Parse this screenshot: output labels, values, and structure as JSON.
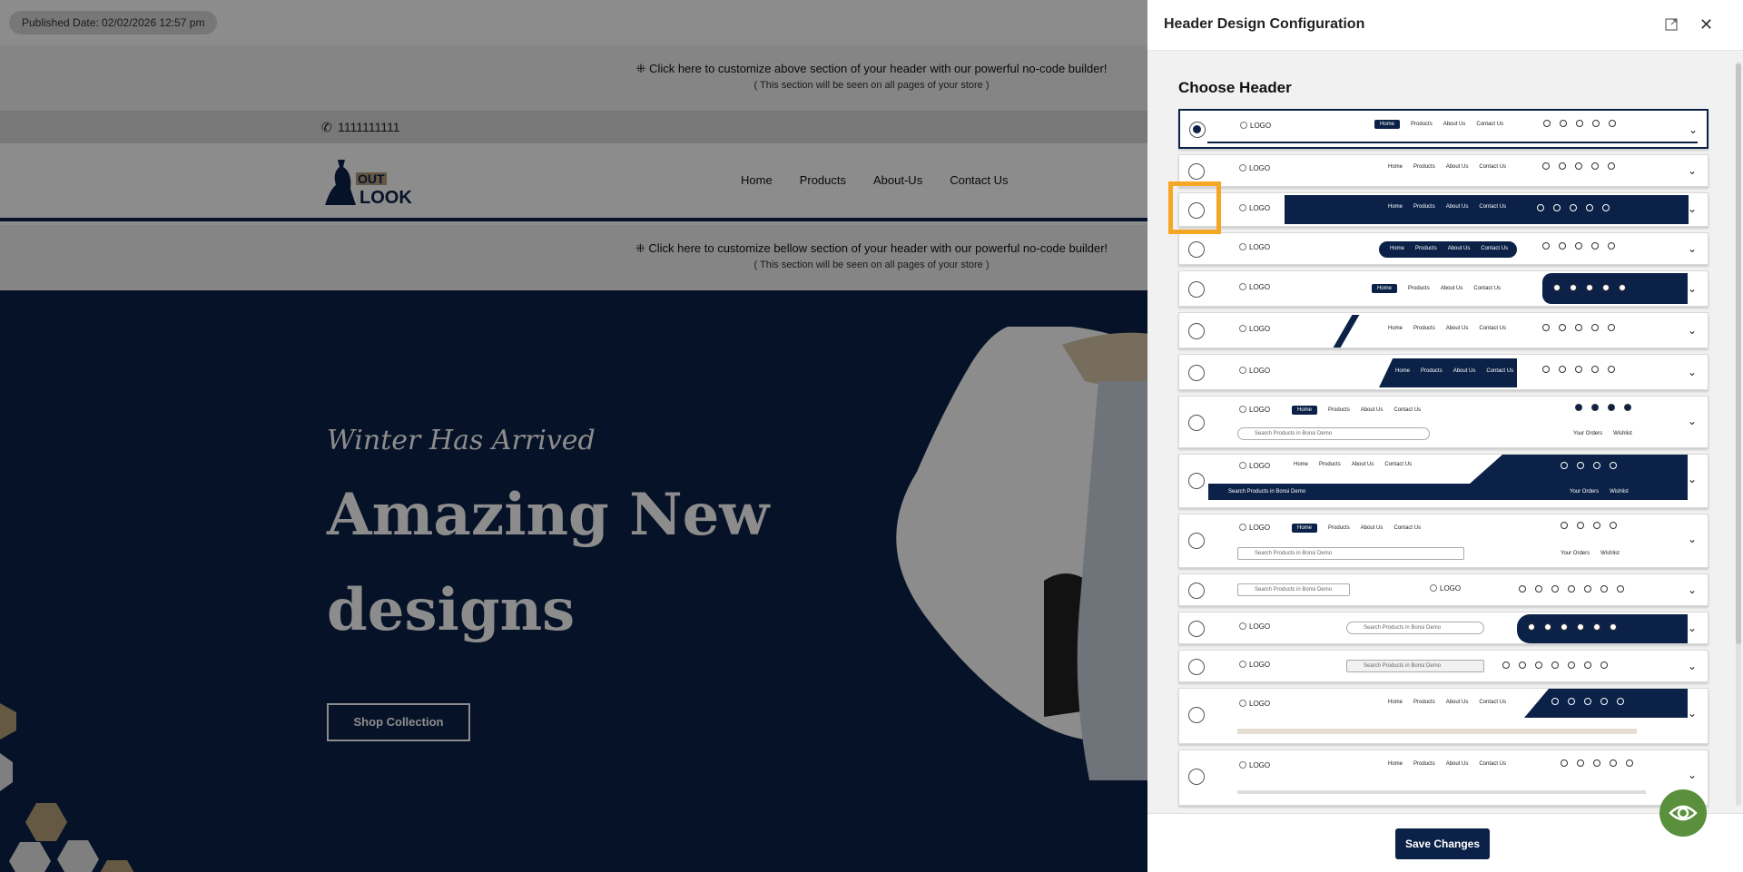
{
  "preview": {
    "published": "Published Date: 02/02/2026 12:57 pm",
    "top_section": {
      "line1": "⁜ Click here to customize above section of your header with our powerful no-code builder!",
      "line2": "( This section will be seen on all pages of your store )"
    },
    "phone": "1111111111",
    "logo_text_1": "OUT",
    "logo_text_2": "LOOK",
    "nav": [
      "Home",
      "Products",
      "About-Us",
      "Contact Us"
    ],
    "bottom_section": {
      "line1": "⁜ Click here to customize bellow section of your header with our powerful no-code builder!",
      "line2": "( This section will be seen on all pages of your store )"
    },
    "hero": {
      "script": "Winter Has Arrived",
      "title_1": "Amazing New",
      "title_2": "designs",
      "button": "Shop Collection"
    }
  },
  "panel": {
    "title": "Header Design Configuration",
    "choose_title": "Choose Header",
    "save_label": "Save Changes"
  },
  "mini": {
    "logo": "LOGO",
    "nav": [
      "Home",
      "Products",
      "About Us",
      "Contact Us"
    ],
    "search": "Search Products in Bonsi Demo",
    "orders": "Your Orders",
    "wishlist": "Wishlist"
  },
  "colors": {
    "brand": "#0b2147",
    "highlight": "#f5a623",
    "eye": "#5a8f3c"
  }
}
